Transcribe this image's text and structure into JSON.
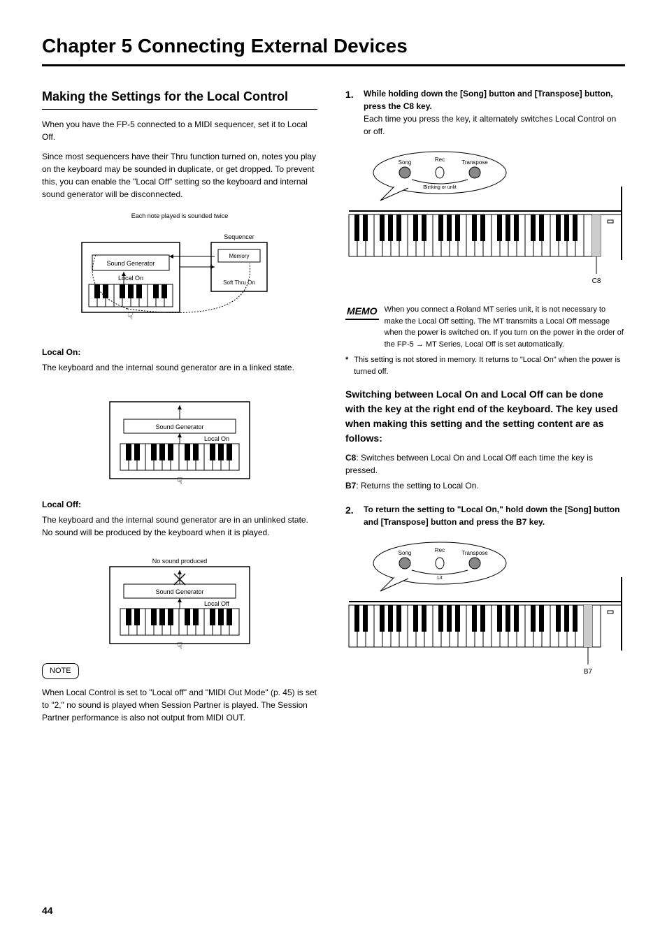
{
  "title": "Chapter 5 Connecting External Devices",
  "pageNumber": "44",
  "left": {
    "sectionHead": "Making the Settings for the Local Control",
    "p1": "When you have the FP-5 connected to a MIDI sequencer, set it to Local Off.",
    "p2": "Since most sequencers have their Thru function turned on, notes you play on the keyboard may be sounded in duplicate, or get dropped. To prevent this, you can enable the \"Local Off\" setting so the keyboard and internal sound generator will be disconnected.",
    "fig1": {
      "seqLabel": "Sequencer",
      "memoryLabel": "Memory",
      "soundGen": "Sound Generator",
      "localOn": "Local On",
      "thruOn": "Soft Thru On",
      "note": "Each note played is sounded twice"
    },
    "localOnHead": "Local On:",
    "localOnText": "The keyboard and the internal sound generator are in a linked state.",
    "localOnFigLabel": "Sound Generator",
    "localOnFigStatus": "Local On",
    "localOffHead": "Local Off:",
    "localOffText": "The keyboard and the internal sound generator are in an unlinked state. No sound will be produced by the keyboard when it is played.",
    "localOffFigLabel": "Sound Generator",
    "localOffFigStatus": "Local Off",
    "localOffFigNote": "No sound produced",
    "noteLabel": "NOTE",
    "noteText": "When Local Control is set to \"Local off\" and \"MIDI Out Mode\" (p. 45) is set to \"2,\" no sound is played when Session Partner is played. The Session Partner performance is also not output from MIDI OUT."
  },
  "right": {
    "step1Num": "1.",
    "step1Title": "While holding down the [Song] button and [Transpose] button, press the C8 key.",
    "step1Text": "Each time you press the key, it alternately switches Local Control on or off.",
    "fig1Labels": {
      "song": "Song",
      "rec": "Rec",
      "transpose": "Transpose",
      "help": "Blinking or unlit",
      "key": "C8"
    },
    "memoIcon": "MEMO",
    "memoText": "When you connect a Roland MT series unit, it is not necessary to make the Local Off setting. The MT transmits a Local Off message when the power is switched on. If you turn on the power in the order of the FP-5 → MT Series, Local Off is set automatically.",
    "asterisk": "This setting is not stored in memory. It returns to \"Local On\" when the power is turned off.",
    "subHead": "Switching between Local On and Local Off can be done with the key at the right end of the keyboard. The key used when making this setting and the setting content are as follows:",
    "keyC8": "C8",
    "keyC8Text": ": Switches between Local On and Local Off each time the key is pressed.",
    "keyB7": "B7",
    "keyB7Text": ": Returns the setting to Local On.",
    "step2Num": "2.",
    "step2Title": "To return the setting to \"Local On,\" hold down the [Song] button and [Transpose] button and press the B7 key.",
    "fig2Labels": {
      "song": "Song",
      "rec": "Rec",
      "transpose": "Transpose",
      "help": "Lit",
      "key": "B7"
    }
  }
}
